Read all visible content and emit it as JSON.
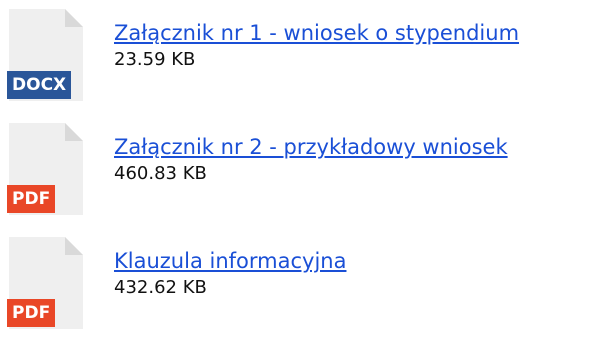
{
  "attachments": [
    {
      "name": "Załącznik nr 1 - wniosek o stypendium",
      "size": "23.59 KB",
      "type": "DOCX",
      "type_color": "#2a5699"
    },
    {
      "name": "Załącznik nr 2 - przykładowy wniosek",
      "size": "460.83 KB",
      "type": "PDF",
      "type_color": "#e94727"
    },
    {
      "name": "Klauzula informacyjna",
      "size": "432.62 KB",
      "type": "PDF",
      "type_color": "#e94727"
    }
  ],
  "colors": {
    "link": "#1a4fd6",
    "text": "#111111",
    "page_icon": "#ececec"
  },
  "icons": [
    "document-icon"
  ]
}
